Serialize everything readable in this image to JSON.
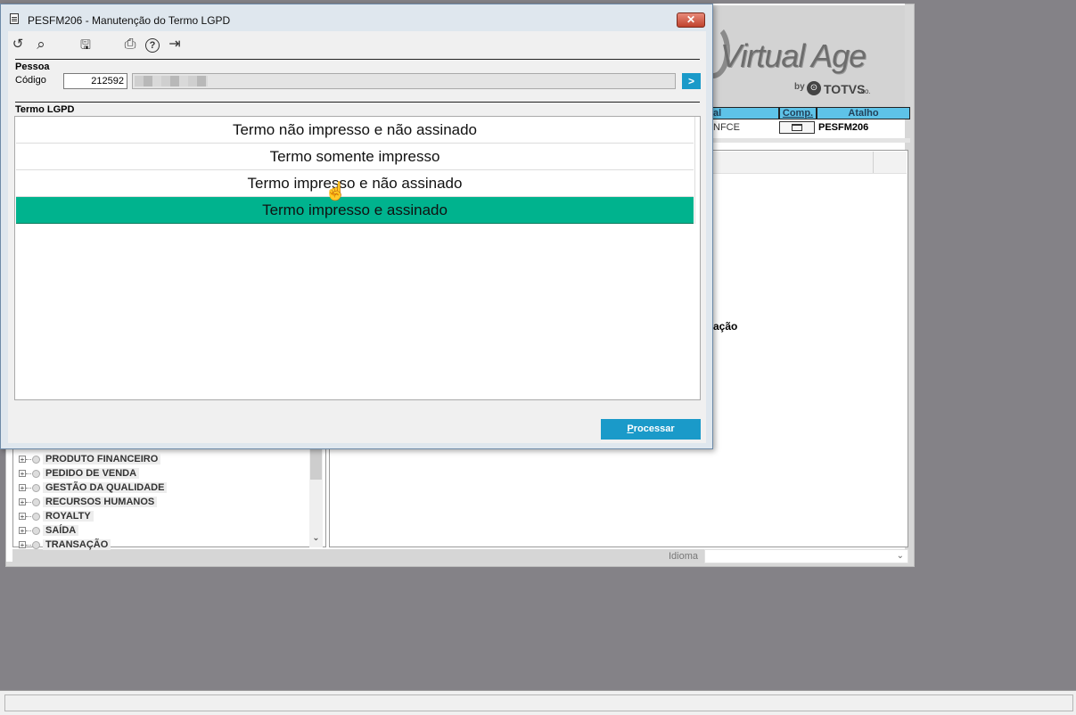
{
  "background": {
    "logo": {
      "brand": "Virtual Age",
      "by": "by",
      "totvs": "TOTVS",
      "co": "co."
    },
    "grid": {
      "headers": [
        "al",
        "Comp.",
        "Atalho"
      ],
      "row": {
        "col1": "NFCE",
        "atalho": "PESFM206"
      }
    },
    "partial_label": "ação",
    "tree_items": [
      "PRODUTO FINANCEIRO",
      "PEDIDO DE VENDA",
      "GESTÃO DA QUALIDADE",
      "RECURSOS HUMANOS",
      "ROYALTY",
      "SAÍDA",
      "TRANSAÇÃO"
    ],
    "idioma_label": "Idioma",
    "colors": {
      "grid_header": "#5ec3e8",
      "desktop": "#848287"
    }
  },
  "dialog": {
    "title": "PESFM206 - Manutenção do Termo LGPD",
    "close_label": "✕",
    "toolbar": [
      {
        "icon": "undo-icon",
        "glyph": "↺"
      },
      {
        "icon": "search-icon",
        "glyph": "⌕"
      },
      {
        "icon": "save-icon",
        "glyph": "🖫"
      },
      {
        "icon": "print-icon",
        "glyph": "⎙"
      },
      {
        "icon": "help-icon",
        "glyph": "?"
      },
      {
        "icon": "exit-icon",
        "glyph": "⇥"
      }
    ],
    "pessoa": {
      "section_label": "Pessoa",
      "codigo_label": "Código",
      "codigo_value": "212592",
      "go_label": ">"
    },
    "termo": {
      "section_label": "Termo LGPD",
      "options": [
        "Termo não impresso e não assinado",
        "Termo somente impresso",
        "Termo impresso e não assinado",
        "Termo impresso e assinado"
      ],
      "selected_index": 3
    },
    "processar_label": "Processar",
    "processar_accel": "P",
    "processar_rest": "rocessar",
    "colors": {
      "selected": "#00b38e",
      "button": "#1a9ac9"
    }
  }
}
